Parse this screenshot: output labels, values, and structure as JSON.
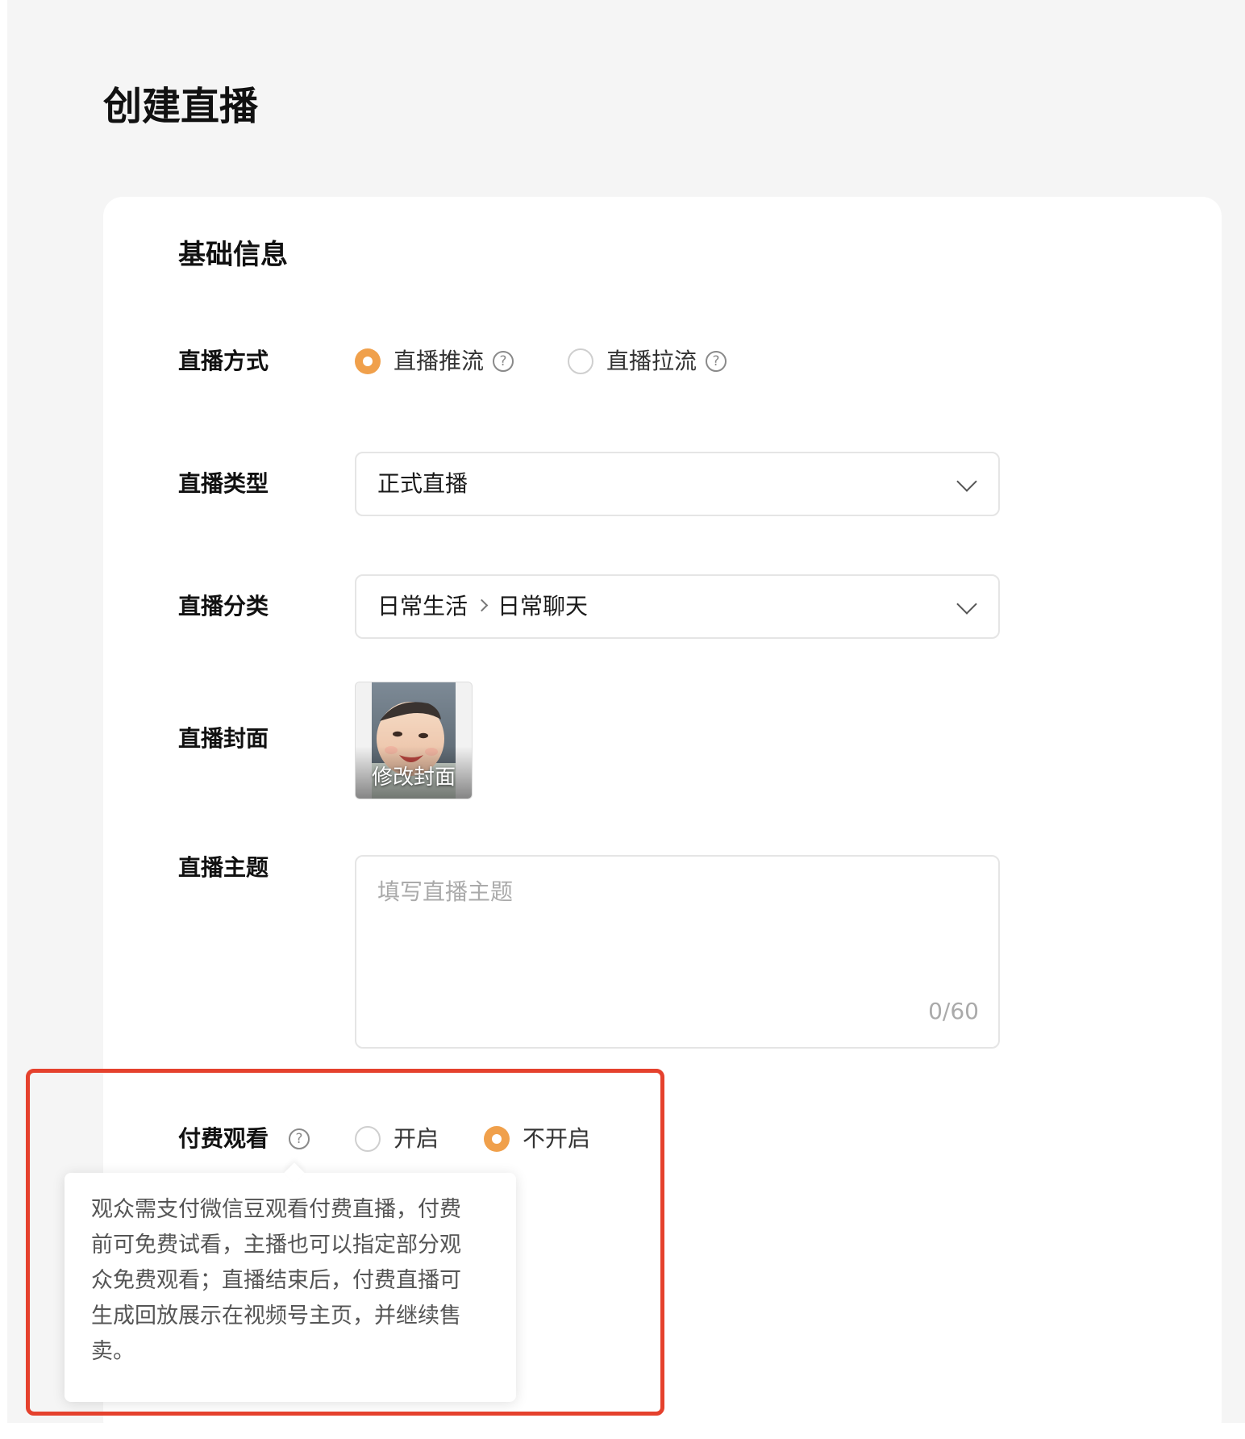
{
  "page": {
    "title": "创建直播"
  },
  "basic_info": {
    "section_title": "基础信息",
    "live_mode": {
      "label": "直播方式",
      "options": [
        {
          "label": "直播推流",
          "checked": true
        },
        {
          "label": "直播拉流",
          "checked": false
        }
      ],
      "help_icon": "question-circle-icon"
    },
    "live_type": {
      "label": "直播类型",
      "value": "正式直播"
    },
    "live_category": {
      "label": "直播分类",
      "value_parent": "日常生活",
      "value_child": "日常聊天"
    },
    "live_cover": {
      "label": "直播封面",
      "edit_label": "修改封面"
    },
    "live_topic": {
      "label": "直播主题",
      "placeholder": "填写直播主题",
      "counter": "0/60"
    },
    "paid_viewing": {
      "label": "付费观看",
      "options": [
        {
          "label": "开启",
          "checked": false
        },
        {
          "label": "不开启",
          "checked": true
        }
      ],
      "tooltip": "观众需支付微信豆观看付费直播，付费前可免费试看，主播也可以指定部分观众免费观看；直播结束后，付费直播可生成回放展示在视频号主页，并继续售卖。"
    }
  },
  "colors": {
    "accent": "#f0a04b",
    "highlight_border": "#e5412d",
    "page_background": "#f5f5f5"
  }
}
